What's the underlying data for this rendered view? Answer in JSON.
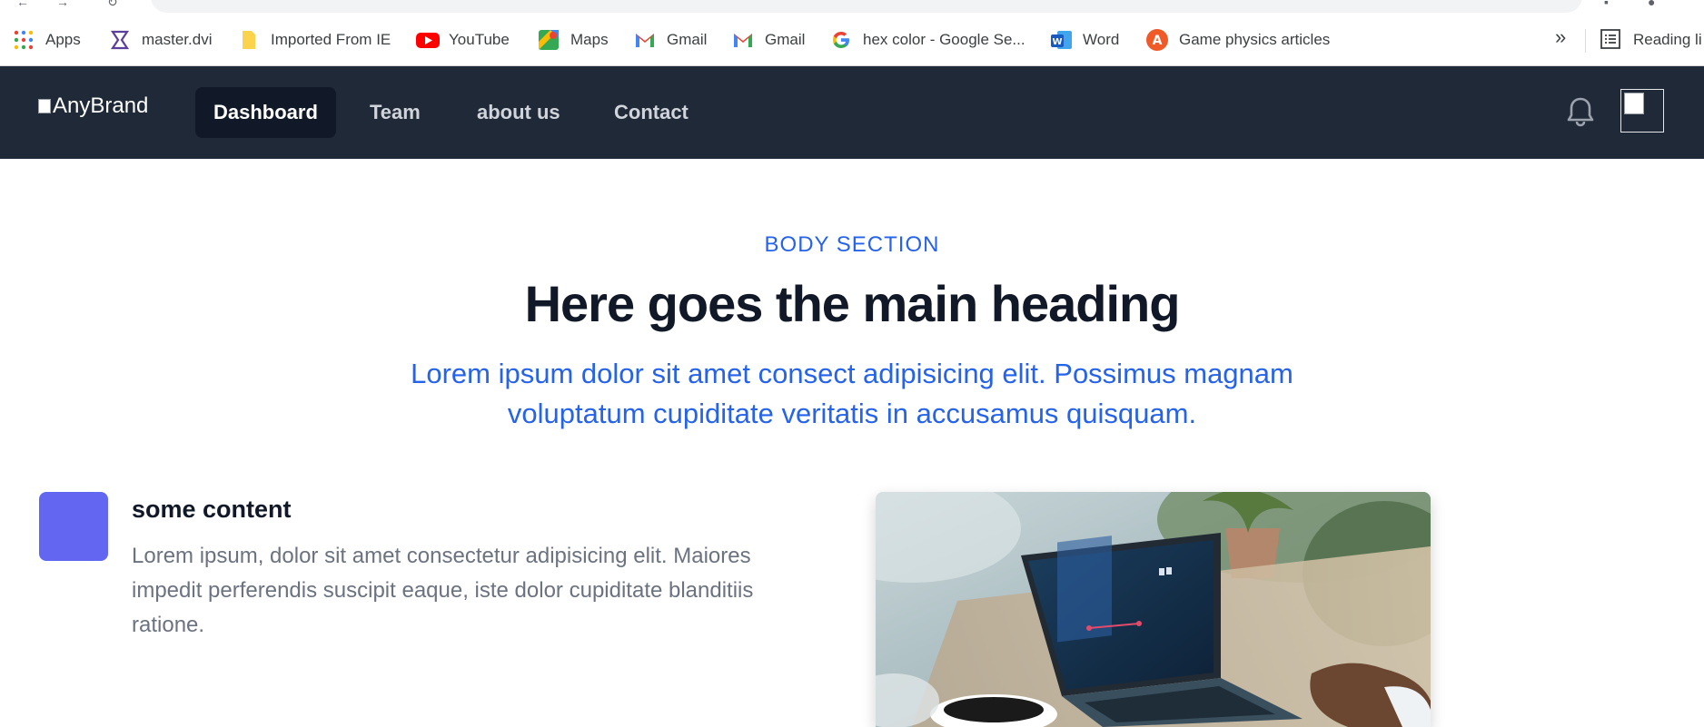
{
  "bookmarks": [
    {
      "label": "Apps",
      "icon": "apps-grid-icon"
    },
    {
      "label": "master.dvi",
      "icon": "master-dvi-icon"
    },
    {
      "label": "Imported From IE",
      "icon": "folder-icon"
    },
    {
      "label": "YouTube",
      "icon": "youtube-icon"
    },
    {
      "label": "Maps",
      "icon": "maps-icon"
    },
    {
      "label": "Gmail",
      "icon": "gmail-icon"
    },
    {
      "label": "Gmail",
      "icon": "gmail-icon"
    },
    {
      "label": "hex color - Google Se...",
      "icon": "google-icon"
    },
    {
      "label": "Word",
      "icon": "word-icon"
    },
    {
      "label": "Game physics articles",
      "icon": "game-physics-icon"
    }
  ],
  "bookmarks_more": "»",
  "reading_list": {
    "label": "Reading li",
    "icon": "reading-list-icon"
  },
  "navbar": {
    "brand": "AnyBrand",
    "links": [
      "Dashboard",
      "Team",
      "about us",
      "Contact"
    ],
    "active_link": "Dashboard"
  },
  "body": {
    "eyebrow": "BODY SECTION",
    "heading": "Here goes the main heading",
    "lead_line1": "Lorem ipsum dolor sit amet consect adipisicing elit. Possimus magnam",
    "lead_line2": "voluptatum cupiditate veritatis in accusamus quisquam.",
    "feature_title": "some content",
    "feature_text_line1": "Lorem ipsum, dolor sit amet consectetur adipisicing elit. Maiores",
    "feature_text_line2": "impedit perferendis suscipit eaque, iste dolor cupiditate blanditiis",
    "feature_text_line3": "ratione."
  },
  "colors": {
    "nav_bg": "#1f2937",
    "nav_active_bg": "#111827",
    "accent_blue": "#2563eb",
    "feature_box": "#6366f1",
    "heading": "#111827",
    "muted_text": "#6b7280"
  }
}
